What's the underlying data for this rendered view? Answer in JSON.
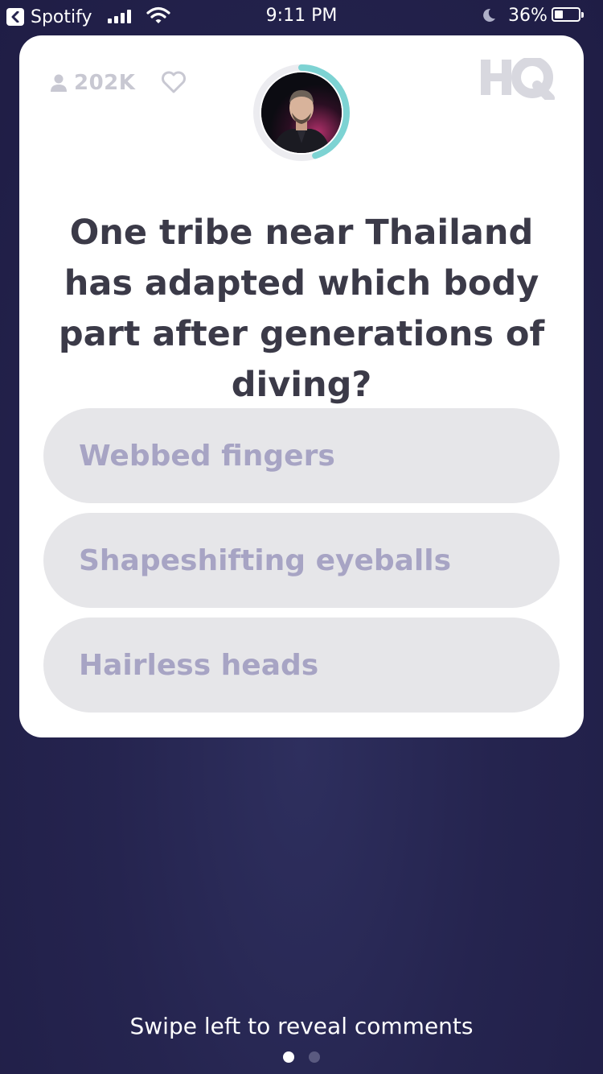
{
  "status_bar": {
    "back_app": "Spotify",
    "time": "9:11 PM",
    "battery_percent": "36%",
    "battery_level": 0.36,
    "signal_bars": 4
  },
  "game": {
    "viewer_count": "202K",
    "logo": "HQ",
    "timer_progress": 0.45,
    "question": "One tribe near Thailand has adapted which body part after generations of diving?",
    "answers": [
      "Webbed fingers",
      "Shapeshifting eyeballs",
      "Hairless heads"
    ]
  },
  "footer": {
    "hint": "Swipe left to reveal comments",
    "pages": 2,
    "active_page": 0
  },
  "colors": {
    "background": "#25244f",
    "card": "#ffffff",
    "question_text": "#3b3a48",
    "answer_bg": "#e6e6e9",
    "answer_text": "#a7a4c4",
    "timer_ring": "#7dd3d3",
    "muted_icon": "#c8c8d2"
  }
}
